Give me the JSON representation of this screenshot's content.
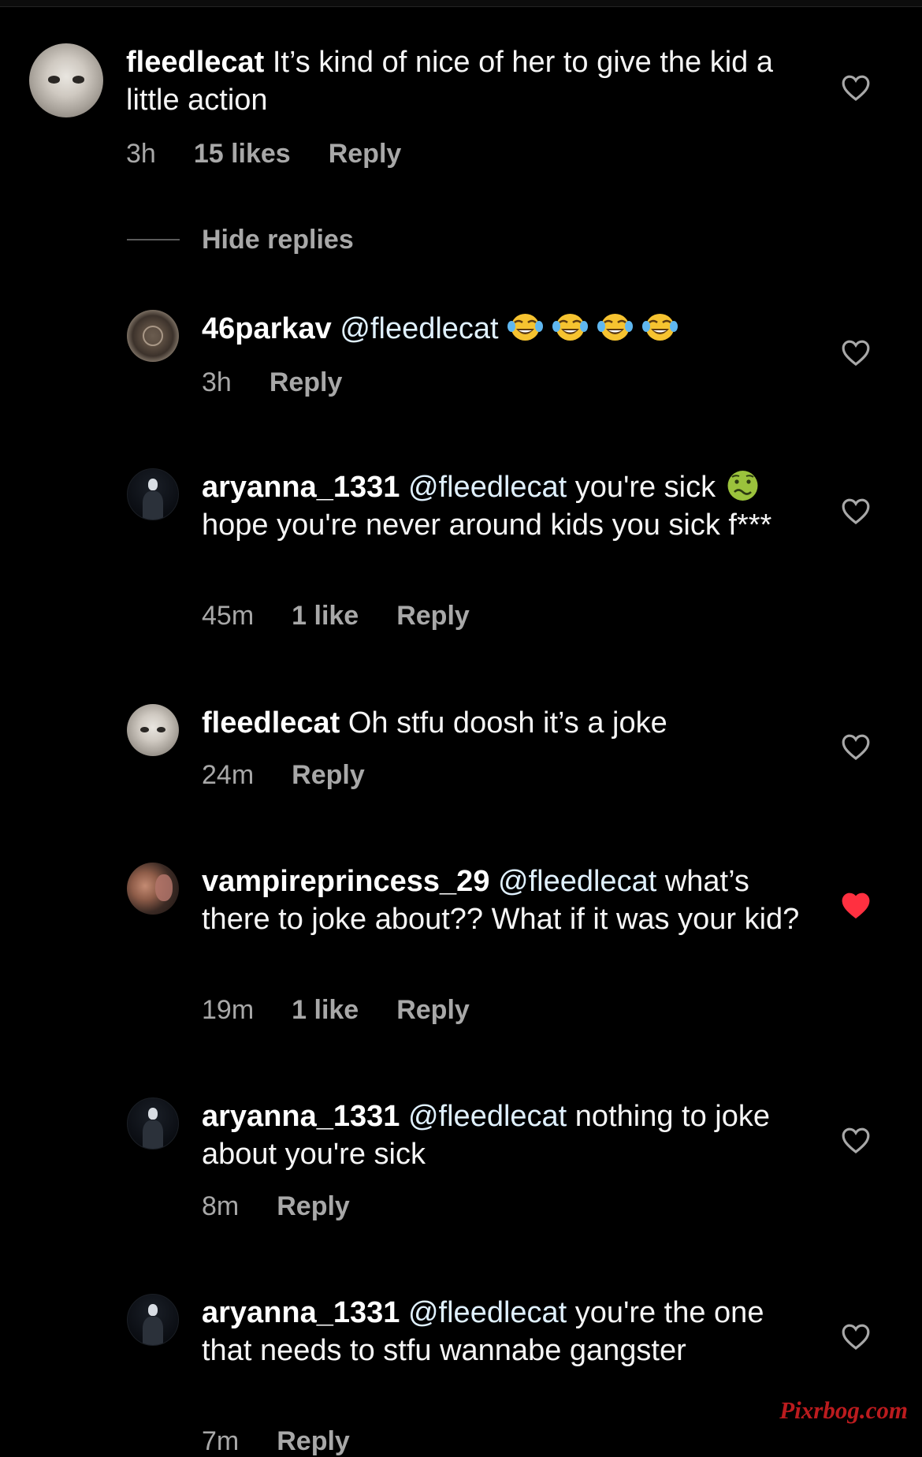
{
  "colors": {
    "background": "#000000",
    "text_primary": "#f5f5f5",
    "text_secondary": "#a8a8a8",
    "mention": "#e0f1ff",
    "heart_liked": "#ff3040",
    "watermark": "#d01f22"
  },
  "thread": {
    "hide_replies_label": "Hide replies",
    "comments": [
      {
        "username": "fleedlecat",
        "avatar": "persian-cat-avatar",
        "text": "It’s kind of nice of her to give the kid a little action",
        "time": "3h",
        "likes": "15 likes",
        "reply_label": "Reply",
        "liked": false
      }
    ],
    "replies": [
      {
        "username": "46parkav",
        "avatar": "coin-avatar",
        "mention": "@fleedlecat",
        "emoji": [
          "face-with-tears-of-joy",
          "face-with-tears-of-joy",
          "face-with-tears-of-joy",
          "face-with-tears-of-joy"
        ],
        "time": "3h",
        "reply_label": "Reply",
        "liked": false
      },
      {
        "username": "aryanna_1331",
        "avatar": "hooded-figure-avatar",
        "mention": "@fleedlecat",
        "text_before_emoji": "you're sick",
        "emoji": "nauseated-face",
        "text": "hope you're never around kids you sick f***",
        "time": "45m",
        "likes": "1 like",
        "reply_label": "Reply",
        "liked": false
      },
      {
        "username": "fleedlecat",
        "avatar": "persian-cat-avatar",
        "text": "Oh stfu doosh it’s a joke",
        "time": "24m",
        "reply_label": "Reply",
        "liked": false
      },
      {
        "username": "vampireprincess_29",
        "avatar": "couple-photo-avatar",
        "mention": "@fleedlecat",
        "text": "what’s there to joke about?? What if it was your kid?",
        "time": "19m",
        "likes": "1 like",
        "reply_label": "Reply",
        "liked": true
      },
      {
        "username": "aryanna_1331",
        "avatar": "hooded-figure-avatar",
        "mention": "@fleedlecat",
        "text": "nothing to joke about you're sick",
        "time": "8m",
        "reply_label": "Reply",
        "liked": false
      },
      {
        "username": "aryanna_1331",
        "avatar": "hooded-figure-avatar",
        "mention": "@fleedlecat",
        "text": "you're the one that needs to stfu wannabe gangster",
        "time": "7m",
        "reply_label": "Reply",
        "liked": false
      }
    ]
  },
  "watermark": "Pixrbog.com"
}
